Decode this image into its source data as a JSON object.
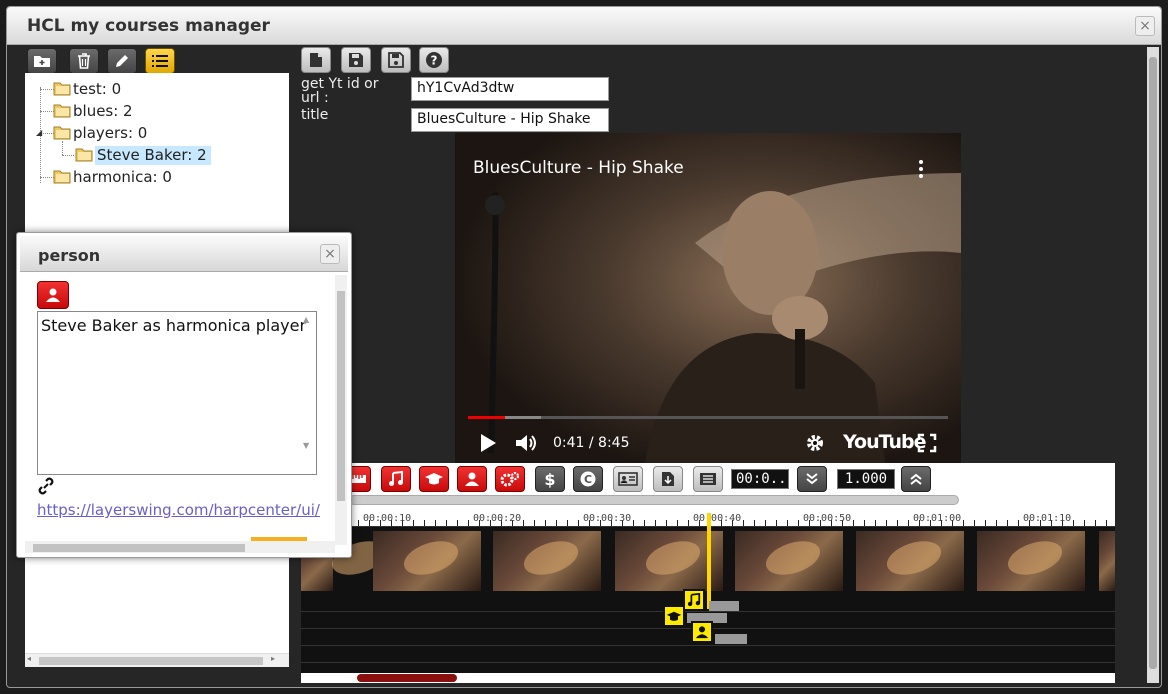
{
  "window": {
    "title": "HCL my courses manager",
    "close_glyph": "×"
  },
  "tree_toolbar": [
    {
      "name": "add-folder-icon"
    },
    {
      "name": "trash-icon"
    },
    {
      "name": "pencil-icon"
    },
    {
      "name": "list-icon"
    }
  ],
  "tree": {
    "items": [
      {
        "label": "test: 0"
      },
      {
        "label": "blues: 2"
      },
      {
        "label": "players: 0"
      },
      {
        "label": "Steve Baker: 2",
        "selected": true
      },
      {
        "label": "harmonica: 0"
      }
    ]
  },
  "editor_toolbar": [
    {
      "name": "new-file-icon"
    },
    {
      "name": "save-icon"
    },
    {
      "name": "save-as-icon"
    },
    {
      "name": "help-icon"
    }
  ],
  "form": {
    "yt_label": "get Yt id or url :",
    "yt_value": "hY1CvAd3dtw",
    "title_label": "title",
    "title_value": "BluesCulture - Hip Shake"
  },
  "video": {
    "title": "BluesCulture - Hip Shake",
    "time": "0:41 / 8:45",
    "brand": "YouTube",
    "progress_fraction": 0.078,
    "buffered_fraction": 0.152
  },
  "timeline": {
    "current_time": "00:0...",
    "speed": "1.000",
    "ruler_labels": [
      "00:00:10",
      "00:00:20",
      "00:00:30",
      "00:00:40",
      "00:00:50",
      "00:01:00",
      "00:01:10"
    ]
  },
  "person": {
    "title": "person",
    "close_glyph": "×",
    "text": "Steve Baker as harmonica player",
    "link": "https://layerswing.com/harpcenter/ui/"
  },
  "colors": {
    "accent_red": "#e01010",
    "marker_yellow": "#ffeb00",
    "link": "#6a5ec8"
  }
}
